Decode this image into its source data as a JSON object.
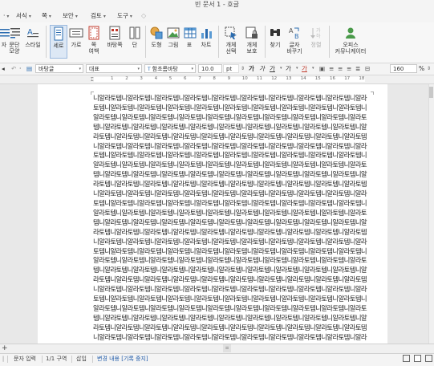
{
  "window": {
    "title": "빈 문서 1 - 호글"
  },
  "menu": [
    {
      "label": "·",
      "has_dropdown": true
    },
    {
      "label": "서식",
      "has_dropdown": true
    },
    {
      "label": "쪽",
      "has_dropdown": true
    },
    {
      "label": "보안",
      "has_dropdown": true
    },
    {
      "label": "검토",
      "has_dropdown": true
    },
    {
      "label": "도구",
      "has_dropdown": true
    }
  ],
  "ribbon": {
    "items": [
      {
        "label": "자",
        "icon": "paragraph-icon"
      },
      {
        "label": "문단",
        "label2": "모양",
        "icon": "paragraph-shape-icon"
      },
      {
        "label": "스타일",
        "icon": "style-icon"
      },
      {
        "label": "세로",
        "icon": "vertical-page-icon",
        "active": true
      },
      {
        "label": "가로",
        "icon": "horizontal-page-icon"
      },
      {
        "label": "쪽",
        "label2": "여백",
        "icon": "page-margin-icon"
      },
      {
        "label": "바탕쪽",
        "icon": "master-page-icon"
      },
      {
        "label": "단",
        "icon": "column-icon"
      },
      {
        "label": "도형",
        "icon": "shape-icon"
      },
      {
        "label": "그림",
        "icon": "picture-icon"
      },
      {
        "label": "표",
        "icon": "table-icon"
      },
      {
        "label": "차트",
        "icon": "chart-icon"
      },
      {
        "label": "개체",
        "label2": "선택",
        "icon": "object-select-icon"
      },
      {
        "label": "개체",
        "label2": "보호",
        "icon": "object-protect-icon"
      },
      {
        "label": "찾기",
        "icon": "find-icon"
      },
      {
        "label": "글자",
        "label2": "바꾸기",
        "icon": "replace-icon"
      },
      {
        "label": "정렬",
        "icon": "sort-icon"
      },
      {
        "label": "오피스",
        "label2": "커뮤니케이터",
        "icon": "office-communicator-icon"
      }
    ]
  },
  "format": {
    "style": "바탕글",
    "lang": "대표",
    "font": "함초롬바탕",
    "size": "10.0",
    "unit": "pt",
    "line_spacing": "160",
    "line_unit": "%"
  },
  "ruler": {
    "numbers": [
      "1",
      "2",
      "3",
      "4",
      "5",
      "6",
      "7",
      "8",
      "9",
      "10",
      "11",
      "12",
      "13",
      "14",
      "15",
      "16",
      "17",
      "18"
    ]
  },
  "document": {
    "text": "니알라토템니알라토템니알라토템니알라토템니알라토템니알라토템니알라토템니알라토템니알라토템니알라토템니알라토템니알라토템니알라토템니알라토템니알라토템니알라토템니알라토템니알라토템니알라토템니알라토템니알라토템니알라토템니알라토템니알라토템니알라토템니알라토템니알라토템니알라토템니알라토템니알라토템니알라토템니알라토템니알라토템니알라토템니알라토템니알라토템니알라토템니알라토템니알라토템니알라토템니알라토템니알라토템니알라토템니알라토템니알라토템니알라토템니알라토템니알라토템니알라토템니알라토템니알라토템니알라토템니알라토템니알라토템니알라토템니알라토템니알라토템니알라토템니알라토템니알라토템니알라토템니알라토템니알라토템니알라토템니알라토템니알라토템니알라토템니알라토템니알라토템니알라토템니알라토템니알라토템니알라토템니알라토템니알라토템니알라토템니알라토템니알라토템니알라토템니알라토템니알라토템니알라토템니알라토템니알라토템니알라토템니알라토템니알라토템니알라토템니알라토템니알라토템니알라토템니알라토템니알라토템니알라토템니알라토템니알라토템니알라토템니알라토템니알라토템니알라토템니알라토템니알라토템니알라토템니알라토템니알라토템니알라토템니알라토템니알라토템니알라토템니알라토템니알라토템니알라토템니알라토템니알라토템니알라토템니알라토템니알라토템니알라토템니알라토템니알라토템니알라토템니알라토템니알라토템니알라토템니알라토템니알라토템니알라토템니알라토템니알라토템니알라토템니알라토템니알라토템니알라토템니알라토템니알라토템니알라토템니알라토템니알라토템니알라토템니알라토템니알라토템니알라토템니알라토템니알라토템니알라토템니알라토템니알라토템니알라토템니알라토템니알라토템니알라토템니알라토템니알라토템니알라토템니알라토템니알라토템니알라토템니알라토템니알라토템니알라토템니알라토템니알라토템니알라토템니알라토템니알라토템니알라토템니알라토템니알라토템니알라토템니알라토템니알라토템니알라토템니알라토템니알라토템니알라토템니알라토템니알라토템니알라토템니알라토템니알라토템니알라토템니알라토템니알라토템니알라토템니알라토템니알라토템니알라토템니알라토템니알라토템니알라토템니알라토템니알라토템니알라토템니알라토템니알라토템니알라토템니알라토템니알라토템니알라토템니알라토템니알라토템니알라토템니알라토템니알라토템니알라토템니알라토템니알라토템니알라토템니알라토템니알라토템니알라토템니알라토템니알라토템니알라토템니알라토템니알라토템니알라토템니알라토템니알라토템니알라토템니알라토템니알라토템니알라토템니알라토템니알라토템니알라토템니알라토템니알라토템니알라토템니알라토템니알라토템니알라토템니알라토템니알라토템니알라토템니알라토템니알라토템니알라토템니알라토템니알라토템니알라토템니알라토템니알라토템니알라토템니알라토템니알라토템니알라토템니알라토템니알라토템니알라토템니알라토템니알라토템니알라토템니알라토템니알라토템니알라토템니알라토템니알라토템니알라토템니알라토템니알라토템니알라토템니알라토템니알라토템니알라토템니알라토템니알라토템니알라토템니알라토템니알라토템니알라토템니알라토템니알라토템니알라토템니알라토템니알라토템니알라토템니알라토템니알라토템니알라토템니알라토템니알라토템니알라토템"
  },
  "tabs": {
    "add": "+"
  },
  "status": {
    "items": [
      "문자 입력",
      "1/1 구역",
      "삽입"
    ],
    "track": "변경 내용 [기록 중지]"
  },
  "colors": {
    "accent": "#2b6cb0",
    "track_text": "#1f5aa8",
    "page_bg": "#ffffff",
    "doc_bg": "#e8e8e8"
  }
}
